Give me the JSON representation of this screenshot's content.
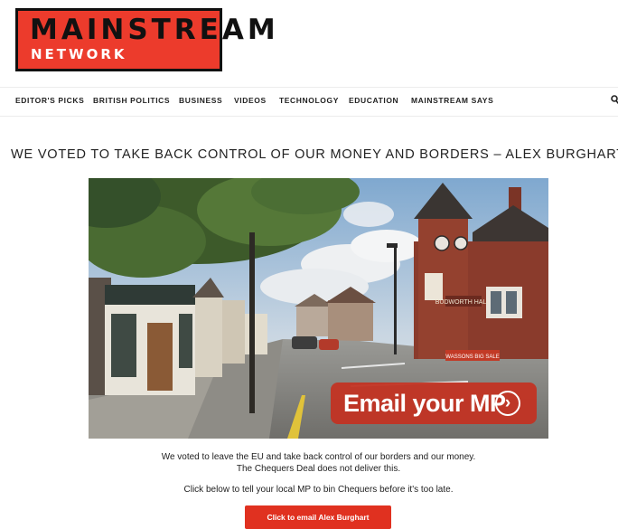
{
  "logo": {
    "line1": "MAINSTREAM",
    "line2": "NETWORK",
    "colors": {
      "background": "#ec3b2c",
      "border": "#111111",
      "text_dark": "#111111",
      "text_light": "#ffffff"
    }
  },
  "nav": {
    "items": [
      {
        "label": "EDITOR'S PICKS"
      },
      {
        "label": "BRITISH POLITICS"
      },
      {
        "label": "BUSINESS"
      },
      {
        "label": "VIDEOS"
      },
      {
        "label": "TECHNOLOGY"
      },
      {
        "label": "EDUCATION"
      },
      {
        "label": "MAINSTREAM SAYS"
      }
    ],
    "search_icon": "search-icon"
  },
  "article": {
    "headline": "WE VOTED TO TAKE BACK CONTROL OF OUR MONEY AND BORDERS – ALEX BURGHART",
    "image": {
      "sign_text": "BUDWORTH HALL",
      "banner_text": "WASSONS BIG SALE",
      "cta_label": "Email your MP",
      "cta_icon": "chevron-right-circle-icon"
    },
    "paragraph1_line1": "We voted to leave the EU and take back control of our borders and our money.",
    "paragraph1_line2": "The Chequers Deal does not deliver this.",
    "paragraph2": "Click below to tell your local MP to bin Chequers before it's too late.",
    "button_label": "Click to email Alex Burghart"
  },
  "colors": {
    "accent": "#e03120",
    "cta_red": "#c0392b"
  }
}
